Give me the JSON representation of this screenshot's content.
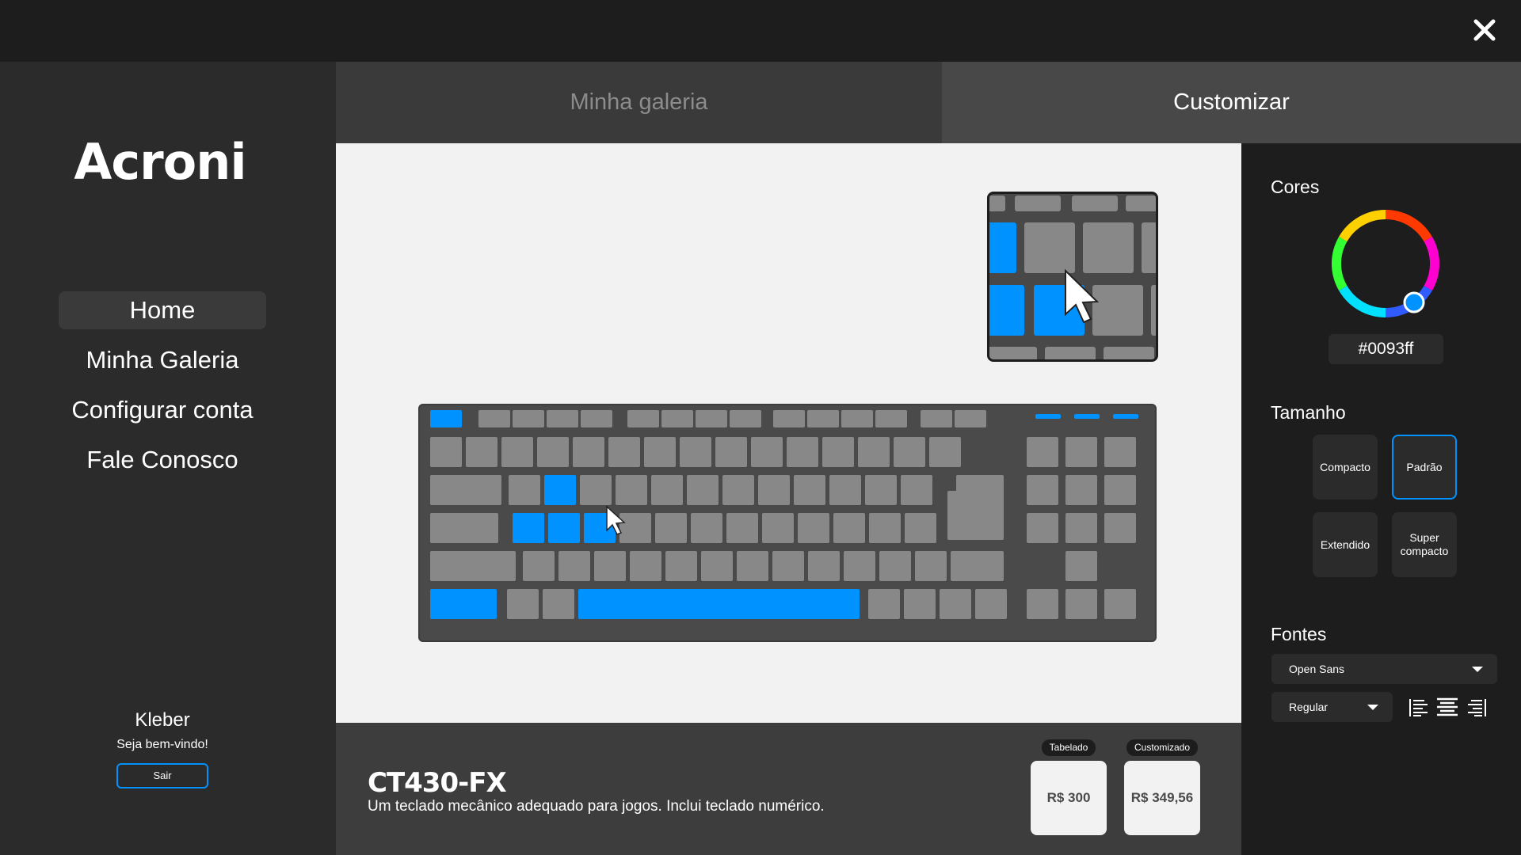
{
  "app": {
    "logo": "Acroni",
    "close_icon": "close-icon"
  },
  "sidebar": {
    "items": [
      {
        "label": "Home",
        "active": true
      },
      {
        "label": "Minha Galeria",
        "active": false
      },
      {
        "label": "Configurar conta",
        "active": false
      },
      {
        "label": "Fale Conosco",
        "active": false
      }
    ],
    "user": {
      "name": "Kleber",
      "welcome": "Seja bem-vindo!",
      "logout_label": "Sair"
    }
  },
  "tabs": [
    {
      "label": "Minha galeria",
      "active": false
    },
    {
      "label": "Customizar",
      "active": true
    }
  ],
  "product": {
    "name": "CT430-FX",
    "description": "Um teclado mecânico adequado para jogos. Inclui teclado numérico.",
    "prices": [
      {
        "tag": "Tabelado",
        "value": "R$ 300"
      },
      {
        "tag": "Customizado",
        "value": "R$ 349,56"
      }
    ]
  },
  "panel": {
    "colors_title": "Cores",
    "hex_value": "#0093ff",
    "size_title": "Tamanho",
    "sizes": [
      {
        "label": "Compacto",
        "active": false
      },
      {
        "label": "Padrão",
        "active": true
      },
      {
        "label": "Extendido",
        "active": false
      },
      {
        "label": "Super compacto",
        "active": false
      }
    ],
    "fonts_title": "Fontes",
    "font_family": "Open Sans",
    "font_weight": "Regular",
    "align_icons": [
      "align-left-icon",
      "align-center-icon",
      "align-right-icon"
    ]
  },
  "colors": {
    "accent": "#0093ff",
    "key_default": "#888888",
    "keyboard_body": "#4a4a4a",
    "canvas_bg": "#f2f2f2"
  }
}
